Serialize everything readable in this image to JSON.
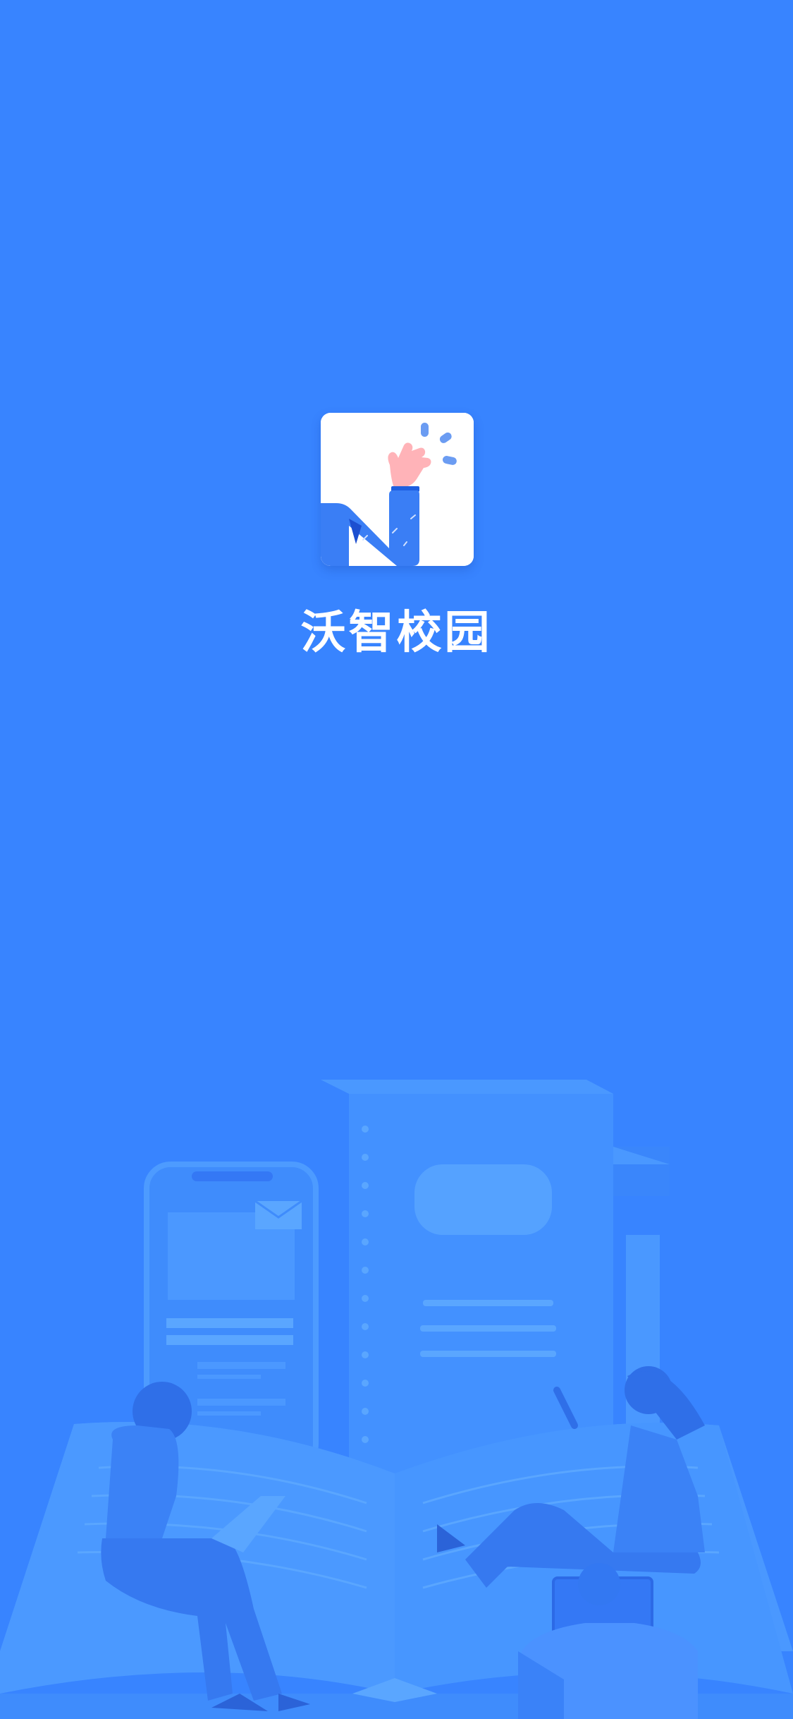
{
  "splash": {
    "app_name": "沃智校园",
    "logo_icon": "waving-hand-logo-icon",
    "illustration": "campus-reading-illustration"
  },
  "colors": {
    "background": "#3884ff",
    "text": "#ffffff",
    "illustration_light": "#4a98ff",
    "illustration_dark": "#2f73f0"
  }
}
